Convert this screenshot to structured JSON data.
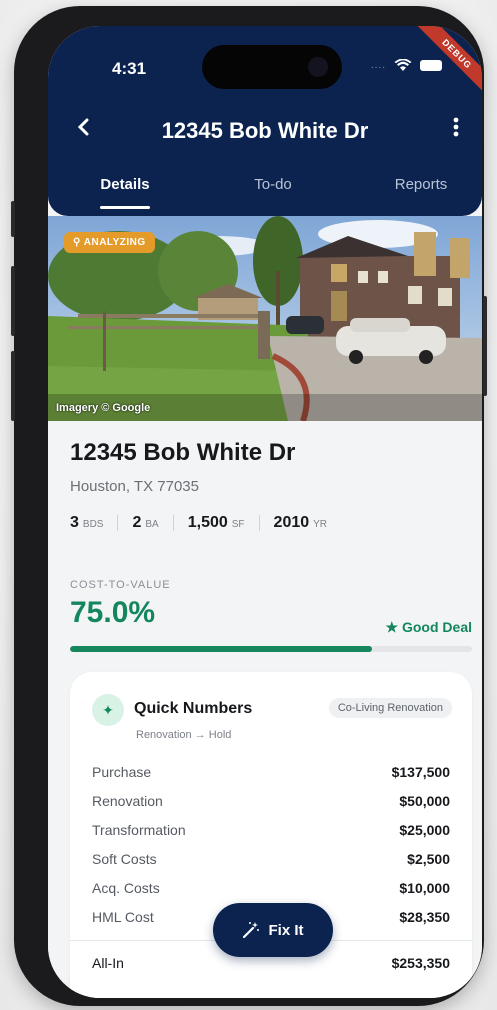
{
  "status_bar": {
    "time": "4:31",
    "dots": "....",
    "debug_label": "DEBUG"
  },
  "header": {
    "title": "12345 Bob White Dr",
    "back_icon": "back-chevron-icon",
    "more_icon": "more-vertical-icon"
  },
  "tabs": [
    {
      "label": "Details",
      "active": true
    },
    {
      "label": "To-do",
      "active": false
    },
    {
      "label": "Reports",
      "active": false
    }
  ],
  "photo": {
    "badge": "ANALYZING",
    "badge_icon": "search-icon",
    "credit": "Imagery © Google"
  },
  "property": {
    "address": "12345 Bob White Dr",
    "city": "Houston, TX 77035",
    "stats": [
      {
        "value": "3",
        "unit": "BDS"
      },
      {
        "value": "2",
        "unit": "BA"
      },
      {
        "value": "1,500",
        "unit": "SF"
      },
      {
        "value": "2010",
        "unit": "YR"
      }
    ]
  },
  "cost_to_value": {
    "label": "COST-TO-VALUE",
    "value": "75.0%",
    "fill_fraction": 0.75,
    "verdict": "Good Deal",
    "verdict_color": "#13865e"
  },
  "quick_numbers": {
    "title": "Quick Numbers",
    "subtitle": "Renovation → Hold",
    "chip": "Co-Living Renovation",
    "rows": [
      {
        "label": "Purchase",
        "value": "$137,500"
      },
      {
        "label": "Renovation",
        "value": "$50,000"
      },
      {
        "label": "Transformation",
        "value": "$25,000"
      },
      {
        "label": "Soft Costs",
        "value": "$2,500"
      },
      {
        "label": "Acq. Costs",
        "value": "$10,000"
      },
      {
        "label": "HML Cost",
        "value": "$28,350"
      }
    ],
    "total": {
      "label": "All-In",
      "value": "$253,350"
    }
  },
  "fab": {
    "label": "Fix It",
    "icon": "magic-wand-icon"
  },
  "colors": {
    "header_bg": "#0c2350",
    "accent_green": "#13865e",
    "badge_orange": "#e49b2a"
  }
}
